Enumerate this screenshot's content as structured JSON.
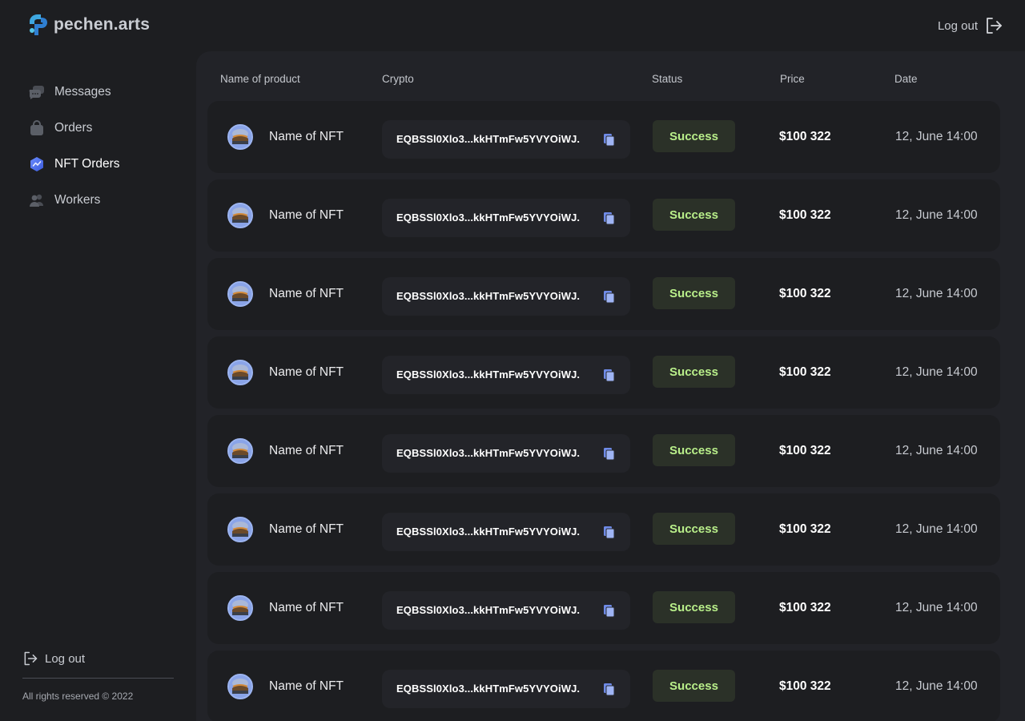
{
  "brand": {
    "name": "pechen.arts"
  },
  "header": {
    "logout_label": "Log out",
    "logout_icon": "logout-icon"
  },
  "sidebar": {
    "items": [
      {
        "label": "Messages",
        "icon": "chat-icon",
        "active": false
      },
      {
        "label": "Orders",
        "icon": "bag-icon",
        "active": false
      },
      {
        "label": "NFT Orders",
        "icon": "nft-hexagon-icon",
        "active": true
      },
      {
        "label": "Workers",
        "icon": "users-icon",
        "active": false
      }
    ],
    "logout_label": "Log out",
    "copyright": "All rights reserved © 2022"
  },
  "table": {
    "columns": {
      "name": "Name of product",
      "crypto": "Crypto",
      "status": "Status",
      "price": "Price",
      "date": "Date"
    },
    "rows": [
      {
        "name": "Name of NFT",
        "crypto": "EQBSSl0Xlo3...kkHTmFw5YVYOiWJ.",
        "status": "Success",
        "price": "$100 322",
        "date": "12, June 14:00"
      },
      {
        "name": "Name of NFT",
        "crypto": "EQBSSl0Xlo3...kkHTmFw5YVYOiWJ.",
        "status": "Success",
        "price": "$100 322",
        "date": "12, June 14:00"
      },
      {
        "name": "Name of NFT",
        "crypto": "EQBSSl0Xlo3...kkHTmFw5YVYOiWJ.",
        "status": "Success",
        "price": "$100 322",
        "date": "12, June 14:00"
      },
      {
        "name": "Name of NFT",
        "crypto": "EQBSSl0Xlo3...kkHTmFw5YVYOiWJ.",
        "status": "Success",
        "price": "$100 322",
        "date": "12, June 14:00"
      },
      {
        "name": "Name of NFT",
        "crypto": "EQBSSl0Xlo3...kkHTmFw5YVYOiWJ.",
        "status": "Success",
        "price": "$100 322",
        "date": "12, June 14:00"
      },
      {
        "name": "Name of NFT",
        "crypto": "EQBSSl0Xlo3...kkHTmFw5YVYOiWJ.",
        "status": "Success",
        "price": "$100 322",
        "date": "12, June 14:00"
      },
      {
        "name": "Name of NFT",
        "crypto": "EQBSSl0Xlo3...kkHTmFw5YVYOiWJ.",
        "status": "Success",
        "price": "$100 322",
        "date": "12, June 14:00"
      },
      {
        "name": "Name of NFT",
        "crypto": "EQBSSl0Xlo3...kkHTmFw5YVYOiWJ.",
        "status": "Success",
        "price": "$100 322",
        "date": "12, June 14:00"
      }
    ]
  },
  "colors": {
    "background": "#1d1e21",
    "panel": "#222328",
    "success_bg": "#2b3128",
    "success_text": "#b9ef8a",
    "accent": "#4a6cf7"
  }
}
